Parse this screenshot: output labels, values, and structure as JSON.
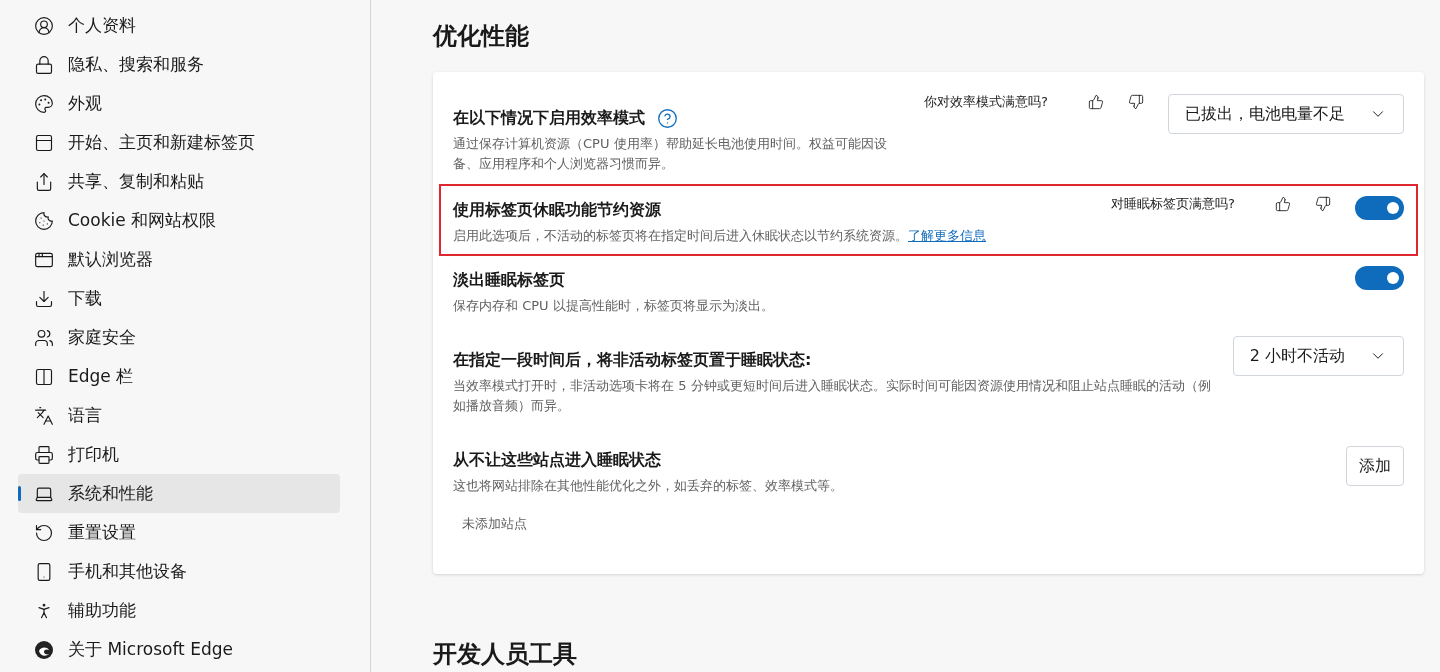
{
  "sidebar": {
    "items": [
      {
        "label": "个人资料",
        "selected": false
      },
      {
        "label": "隐私、搜索和服务",
        "selected": false
      },
      {
        "label": "外观",
        "selected": false
      },
      {
        "label": "开始、主页和新建标签页",
        "selected": false
      },
      {
        "label": "共享、复制和粘贴",
        "selected": false
      },
      {
        "label": "Cookie 和网站权限",
        "selected": false
      },
      {
        "label": "默认浏览器",
        "selected": false
      },
      {
        "label": "下载",
        "selected": false
      },
      {
        "label": "家庭安全",
        "selected": false
      },
      {
        "label": "Edge 栏",
        "selected": false
      },
      {
        "label": "语言",
        "selected": false
      },
      {
        "label": "打印机",
        "selected": false
      },
      {
        "label": "系统和性能",
        "selected": true
      },
      {
        "label": "重置设置",
        "selected": false
      },
      {
        "label": "手机和其他设备",
        "selected": false
      },
      {
        "label": "辅助功能",
        "selected": false
      },
      {
        "label": "关于 Microsoft Edge",
        "selected": false
      }
    ]
  },
  "section": {
    "title": "优化性能",
    "rows": [
      {
        "kind": "dropdown",
        "title": "在以下情况下启用效率模式",
        "help": true,
        "description": "通过保存计算机资源（CPU 使用率）帮助延长电池使用时间。权益可能因设备、应用程序和个人浏览器习惯而异。",
        "feedback": "你对效率模式满意吗?",
        "value": "已拔出，电池电量不足"
      },
      {
        "kind": "toggle",
        "title": "使用标签页休眠功能节约资源",
        "highlighted": true,
        "description": "启用此选项后，不活动的标签页将在指定时间后进入休眠状态以节约系统资源。",
        "link": "了解更多信息",
        "feedback": "对睡眠标签页满意吗?",
        "on": true
      },
      {
        "kind": "toggle",
        "title": "淡出睡眠标签页",
        "description": "保存内存和 CPU 以提高性能时，标签页将显示为淡出。",
        "on": true
      },
      {
        "kind": "dropdown",
        "title": "在指定一段时间后，将非活动标签页置于睡眠状态:",
        "description": "当效率模式打开时，非活动选项卡将在 5 分钟或更短时间后进入睡眠状态。实际时间可能因资源使用情况和阻止站点睡眠的活动（例如播放音频）而异。",
        "value": "2 小时不活动"
      },
      {
        "kind": "add",
        "title": "从不让这些站点进入睡眠状态",
        "description": "这也将网站排除在其他性能优化之外，如丢弃的标签、效率模式等。",
        "button": "添加",
        "empty_note": "未添加站点"
      }
    ]
  },
  "next_section": {
    "title": "开发人员工具"
  }
}
